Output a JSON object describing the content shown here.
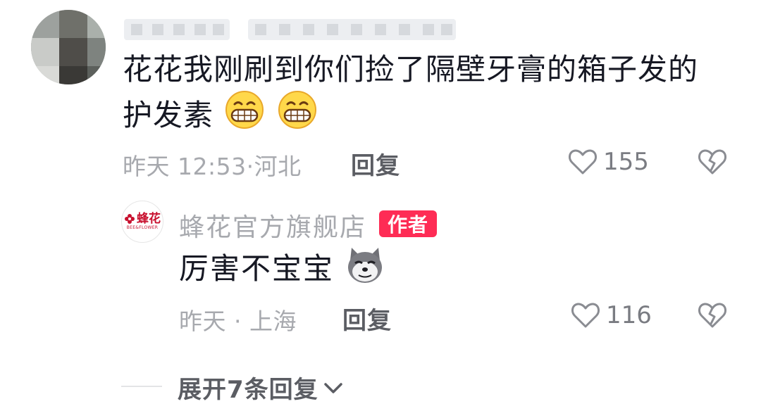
{
  "comment": {
    "text_line1": "花花我刚刷到你们捡了隔壁牙膏的箱子发的",
    "text_line2": "护发素",
    "time": "昨天 12:53",
    "location_sep": "·",
    "location": "河北",
    "reply_label": "回复",
    "like_count": "155",
    "emojis": [
      "grin-emoji",
      "grin-emoji"
    ]
  },
  "reply": {
    "username": "蜂花官方旗舰店",
    "badge": "作者",
    "avatar_brand": "蜂花",
    "avatar_brand_sub": "BEE&FLOWER",
    "text": "厉害不宝宝",
    "emoji": "husky-dog-emoji",
    "time": "昨天",
    "location_sep": "·",
    "location": "上海",
    "reply_label": "回复",
    "like_count": "116"
  },
  "expand": {
    "label": "展开7条回复",
    "icon": "chevron-down-icon"
  },
  "colors": {
    "accent": "#fe2c55",
    "brand_red": "#c8102e",
    "text_primary": "#161823",
    "text_secondary": "#a7a9ae"
  }
}
